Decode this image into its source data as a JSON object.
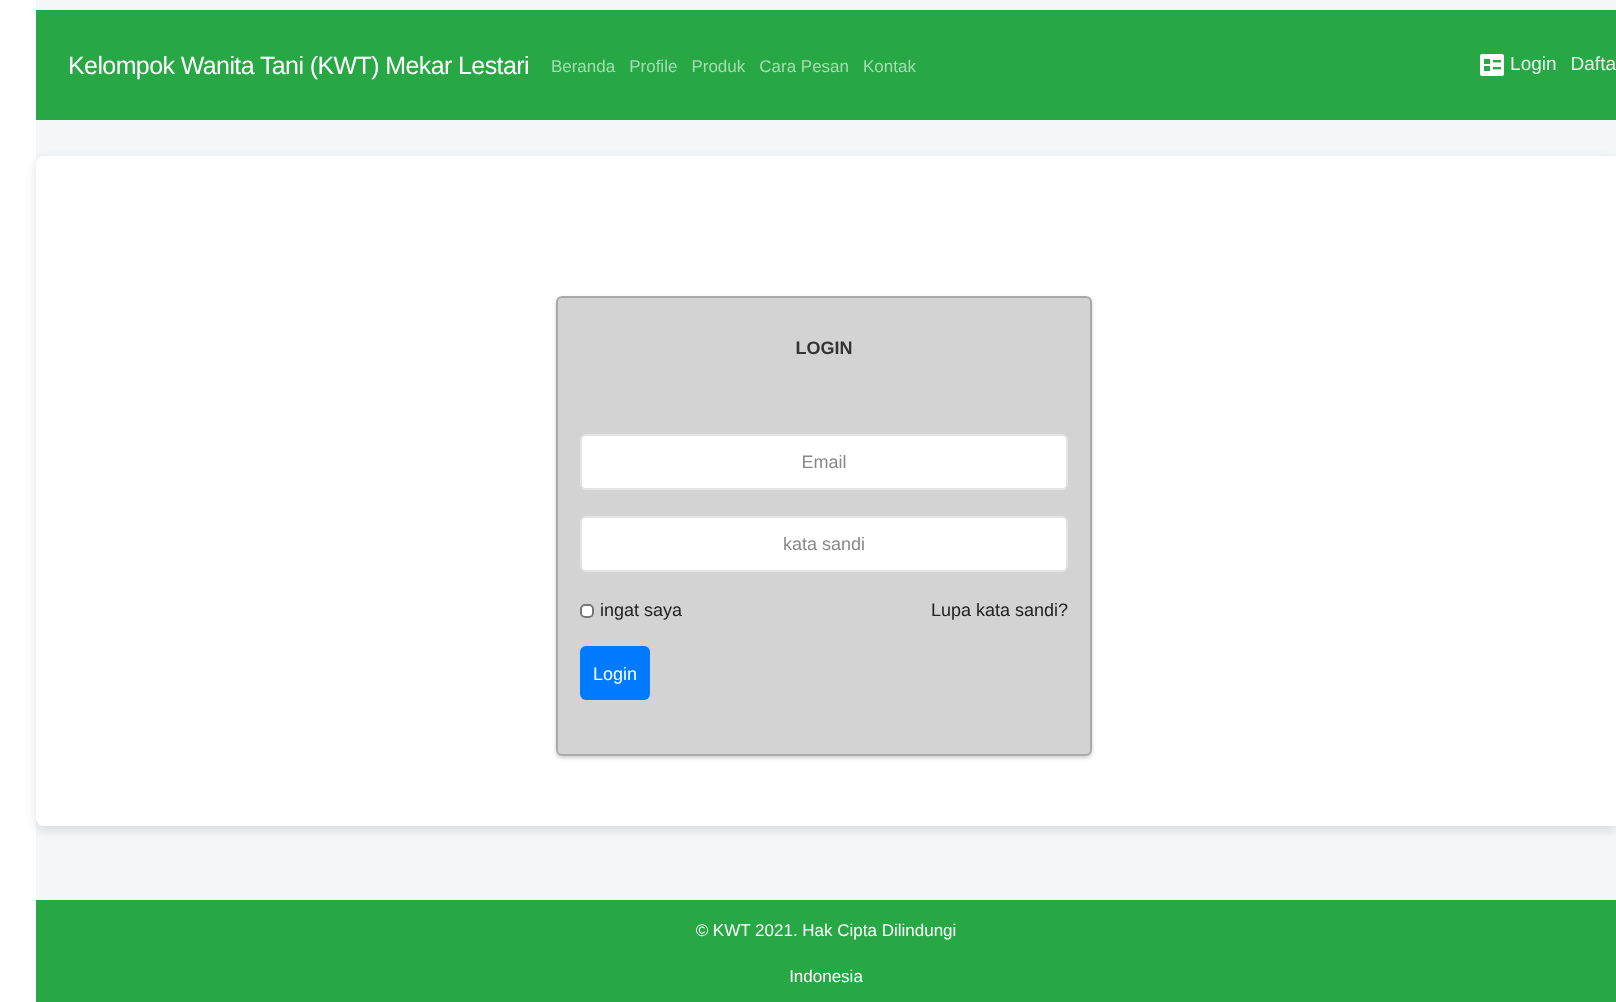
{
  "navbar": {
    "brand": "Kelompok Wanita Tani (KWT) Mekar Lestari",
    "links": [
      "Beranda",
      "Profile",
      "Produk",
      "Cara Pesan",
      "Kontak"
    ],
    "right_links": [
      "Login",
      "Dafta"
    ]
  },
  "login": {
    "title": "LOGIN",
    "email": {
      "placeholder": "Email"
    },
    "password": {
      "placeholder": "kata sandi"
    },
    "remember": {
      "label": "ingat saya",
      "checked": false
    },
    "forgot": "Lupa kata sandi?",
    "button": "Login"
  },
  "footer": {
    "lines": [
      "© KWT 2021. Hak Cipta Dilindungi",
      "Indonesia"
    ]
  }
}
